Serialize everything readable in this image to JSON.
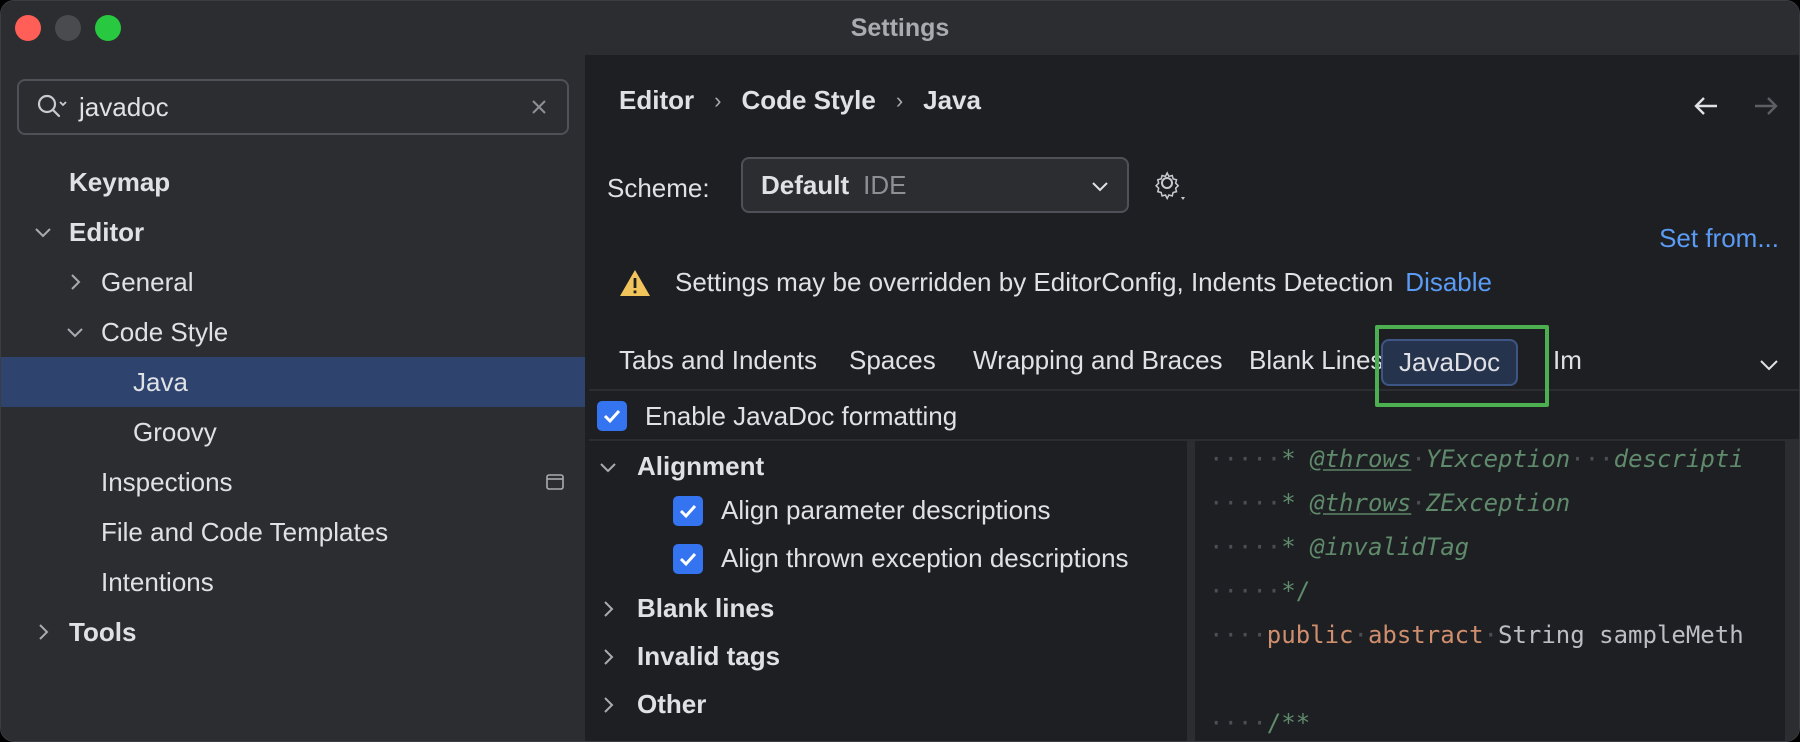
{
  "window": {
    "title": "Settings"
  },
  "search": {
    "value": "javadoc"
  },
  "sidebar": {
    "items": [
      {
        "label": "Keymap"
      },
      {
        "label": "Editor"
      },
      {
        "label": "General"
      },
      {
        "label": "Code Style"
      },
      {
        "label": "Java"
      },
      {
        "label": "Groovy"
      },
      {
        "label": "Inspections"
      },
      {
        "label": "File and Code Templates"
      },
      {
        "label": "Intentions"
      },
      {
        "label": "Tools"
      }
    ]
  },
  "breadcrumb": {
    "items": [
      "Editor",
      "Code Style",
      "Java"
    ],
    "separator": "›"
  },
  "scheme": {
    "label": "Scheme:",
    "name": "Default",
    "kind": "IDE"
  },
  "set_from": "Set from...",
  "warning": {
    "text": "Settings may be overridden by EditorConfig, Indents Detection",
    "link": "Disable"
  },
  "tabs": [
    "Tabs and Indents",
    "Spaces",
    "Wrapping and Braces",
    "Blank Lines",
    "JavaDoc",
    "Im"
  ],
  "enable": {
    "label": "Enable JavaDoc formatting",
    "checked": true
  },
  "options": {
    "alignment": "Alignment",
    "align_param": "Align parameter descriptions",
    "align_thrown": "Align thrown exception descriptions",
    "blank_lines": "Blank lines",
    "invalid_tags": "Invalid tags",
    "other": "Other"
  },
  "code": {
    "l1_tag": "@throws",
    "l1_type": "YException",
    "l1_desc": "descripti",
    "l2_tag": "@throws",
    "l2_type": "ZException",
    "l3_tag": "@invalidTag",
    "l4": "*/",
    "l5_kw1": "public",
    "l5_kw2": "abstract",
    "l5_rest": "String sampleMeth",
    "l7": "/**"
  },
  "colors": {
    "accent": "#3574f0",
    "link": "#5a9bf5",
    "selection": "#2e436e",
    "highlight": "#4caf50"
  }
}
